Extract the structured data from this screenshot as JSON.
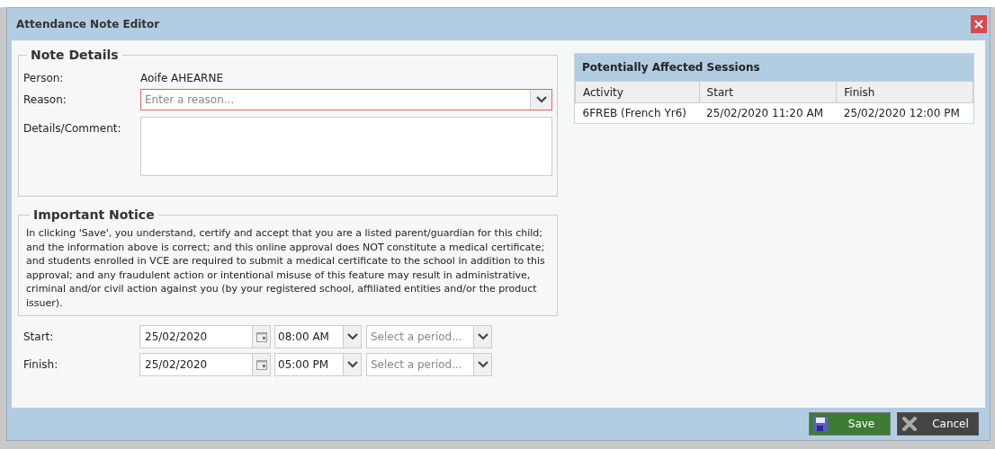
{
  "window": {
    "title": "Attendance Note Editor",
    "close_label": "×"
  },
  "note_details": {
    "legend": "Note Details",
    "person_label": "Person:",
    "person_value": "Aoife AHEARNE",
    "reason_label": "Reason:",
    "reason_placeholder": "Enter a reason...",
    "reason_invalid": true,
    "details_label": "Details/Comment:"
  },
  "notice": {
    "legend": "Important Notice",
    "text": "In clicking 'Save', you understand, certify and accept that you are a listed parent/guardian for this child; and the information above is correct; and this online approval does NOT constitute a medical certificate; and students enrolled in VCE are required to submit a medical certificate to the school in addition to this approval; and any fraudulent action or intentional misuse of this feature may result in administrative, criminal and/or civil action against you (by your registered school, affiliated entities and/or the product issuer)."
  },
  "times": [
    {
      "label": "Start:",
      "date": "25/02/2020",
      "time": "08:00 AM",
      "period_placeholder": "Select a period..."
    },
    {
      "label": "Finish:",
      "date": "25/02/2020",
      "time": "05:00 PM",
      "period_placeholder": "Select a period..."
    }
  ],
  "sessions": {
    "title": "Potentially Affected Sessions",
    "columns": [
      "Activity",
      "Start",
      "Finish"
    ],
    "rows": [
      [
        "6FREB (French Yr6)",
        "25/02/2020 11:20 AM",
        "25/02/2020 12:00 PM"
      ]
    ]
  },
  "buttons": [
    {
      "kind": "save",
      "label": "Save"
    },
    {
      "kind": "cancel",
      "label": "Cancel"
    }
  ]
}
